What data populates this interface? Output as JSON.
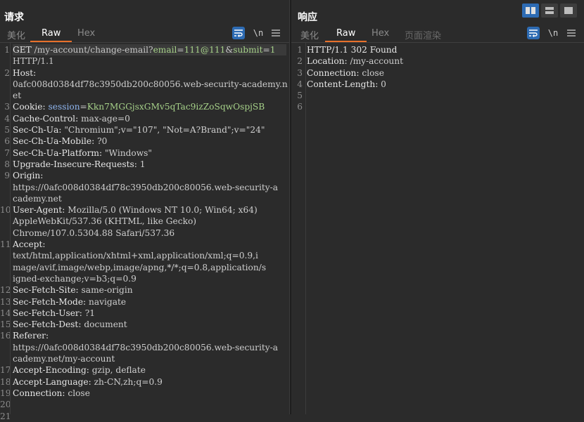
{
  "request": {
    "title": "请求",
    "tabs": [
      {
        "label": "美化",
        "state": "inactive"
      },
      {
        "label": "Raw",
        "state": "active"
      },
      {
        "label": "Hex",
        "state": "inactive"
      }
    ],
    "newline_toggle": "\\n",
    "menu_icon": "hamburger-menu-icon",
    "gutter": [
      "1",
      "",
      "2",
      "",
      "",
      "3",
      "4",
      "5",
      "6",
      "7",
      "8",
      "9",
      "",
      "",
      "10",
      "",
      "",
      "11",
      "",
      "",
      "",
      "12",
      "13",
      "14",
      "15",
      "16",
      "",
      "",
      "17",
      "18",
      "19",
      "20",
      "21"
    ],
    "lines": [
      {
        "seg": [
          [
            "m",
            "GET "
          ],
          [
            "u",
            "/my-account/change-email?"
          ],
          [
            "pn",
            "email"
          ],
          [
            "u",
            "="
          ],
          [
            "pv",
            "111@111"
          ],
          [
            "u",
            "&"
          ],
          [
            "pn",
            "submit"
          ],
          [
            "u",
            "="
          ],
          [
            "pv",
            "1"
          ]
        ]
      },
      {
        "seg": [
          [
            "u",
            "HTTP/1.1"
          ]
        ]
      },
      {
        "seg": [
          [
            "hk",
            "Host:"
          ]
        ]
      },
      {
        "seg": [
          [
            "hv",
            "0afc008d0384df78c3950db200c80056.web-security-academy.n"
          ]
        ]
      },
      {
        "seg": [
          [
            "hv",
            "et"
          ]
        ]
      },
      {
        "seg": [
          [
            "hk",
            "Cookie: "
          ],
          [
            "ck",
            "session"
          ],
          [
            "u",
            "="
          ],
          [
            "cv",
            "Kkn7MGGjsxGMv5qTac9izZoSqwOspjSB"
          ]
        ]
      },
      {
        "seg": [
          [
            "hk",
            "Cache-Control: "
          ],
          [
            "hv",
            "max-age=0"
          ]
        ]
      },
      {
        "seg": [
          [
            "hk",
            "Sec-Ch-Ua: "
          ],
          [
            "hv",
            "\"Chromium\";v=\"107\", \"Not=A?Brand\";v=\"24\""
          ]
        ]
      },
      {
        "seg": [
          [
            "hk",
            "Sec-Ch-Ua-Mobile: "
          ],
          [
            "hv",
            "?0"
          ]
        ]
      },
      {
        "seg": [
          [
            "hk",
            "Sec-Ch-Ua-Platform: "
          ],
          [
            "hv",
            "\"Windows\""
          ]
        ]
      },
      {
        "seg": [
          [
            "hk",
            "Upgrade-Insecure-Requests: "
          ],
          [
            "hv",
            "1"
          ]
        ]
      },
      {
        "seg": [
          [
            "hk",
            "Origin:"
          ]
        ]
      },
      {
        "seg": [
          [
            "hv",
            "https://0afc008d0384df78c3950db200c80056.web-security-a"
          ]
        ]
      },
      {
        "seg": [
          [
            "hv",
            "cademy.net"
          ]
        ]
      },
      {
        "seg": [
          [
            "hk",
            "User-Agent: "
          ],
          [
            "hv",
            "Mozilla/5.0 (Windows NT 10.0; Win64; x64)"
          ]
        ]
      },
      {
        "seg": [
          [
            "hv",
            "AppleWebKit/537.36 (KHTML, like Gecko)"
          ]
        ]
      },
      {
        "seg": [
          [
            "hv",
            "Chrome/107.0.5304.88 Safari/537.36"
          ]
        ]
      },
      {
        "seg": [
          [
            "hk",
            "Accept:"
          ]
        ]
      },
      {
        "seg": [
          [
            "hv",
            "text/html,application/xhtml+xml,application/xml;q=0.9,i"
          ]
        ]
      },
      {
        "seg": [
          [
            "hv",
            "mage/avif,image/webp,image/apng,*/*;q=0.8,application/s"
          ]
        ]
      },
      {
        "seg": [
          [
            "hv",
            "igned-exchange;v=b3;q=0.9"
          ]
        ]
      },
      {
        "seg": [
          [
            "hk",
            "Sec-Fetch-Site: "
          ],
          [
            "hv",
            "same-origin"
          ]
        ]
      },
      {
        "seg": [
          [
            "hk",
            "Sec-Fetch-Mode: "
          ],
          [
            "hv",
            "navigate"
          ]
        ]
      },
      {
        "seg": [
          [
            "hk",
            "Sec-Fetch-User: "
          ],
          [
            "hv",
            "?1"
          ]
        ]
      },
      {
        "seg": [
          [
            "hk",
            "Sec-Fetch-Dest: "
          ],
          [
            "hv",
            "document"
          ]
        ]
      },
      {
        "seg": [
          [
            "hk",
            "Referer:"
          ]
        ]
      },
      {
        "seg": [
          [
            "hv",
            "https://0afc008d0384df78c3950db200c80056.web-security-a"
          ]
        ]
      },
      {
        "seg": [
          [
            "hv",
            "cademy.net/my-account"
          ]
        ]
      },
      {
        "seg": [
          [
            "hk",
            "Accept-Encoding: "
          ],
          [
            "hv",
            "gzip, deflate"
          ]
        ]
      },
      {
        "seg": [
          [
            "hk",
            "Accept-Language: "
          ],
          [
            "hv",
            "zh-CN,zh;q=0.9"
          ]
        ]
      },
      {
        "seg": [
          [
            "hk",
            "Connection: "
          ],
          [
            "hv",
            "close"
          ]
        ]
      },
      {
        "seg": [
          [
            "hv",
            ""
          ]
        ]
      },
      {
        "seg": [
          [
            "hv",
            ""
          ]
        ]
      }
    ]
  },
  "response": {
    "title": "响应",
    "tabs": [
      {
        "label": "美化",
        "state": "inactive"
      },
      {
        "label": "Raw",
        "state": "active"
      },
      {
        "label": "Hex",
        "state": "inactive"
      },
      {
        "label": "页面渲染",
        "state": "disabled"
      }
    ],
    "newline_toggle": "\\n",
    "menu_icon": "hamburger-menu-icon",
    "gutter": [
      "1",
      "2",
      "3",
      "4",
      "5",
      "6"
    ],
    "lines": [
      {
        "seg": [
          [
            "m",
            "HTTP/1.1 302 Found"
          ]
        ]
      },
      {
        "seg": [
          [
            "hk",
            "Location: "
          ],
          [
            "hv",
            "/my-account"
          ]
        ]
      },
      {
        "seg": [
          [
            "hk",
            "Connection: "
          ],
          [
            "hv",
            "close"
          ]
        ]
      },
      {
        "seg": [
          [
            "hk",
            "Content-Length: "
          ],
          [
            "hv",
            "0"
          ]
        ]
      },
      {
        "seg": [
          [
            "hv",
            ""
          ]
        ]
      },
      {
        "seg": [
          [
            "hv",
            ""
          ]
        ]
      }
    ]
  },
  "layout_switcher": [
    {
      "icon": "split-horizontal-layout-icon",
      "active": true
    },
    {
      "icon": "split-vertical-layout-icon",
      "active": false
    },
    {
      "icon": "tabs-layout-icon",
      "active": false
    }
  ],
  "colors": {
    "accent": "#e8702a",
    "button_blue": "#2d6bb3",
    "background": "#2b2b2b"
  }
}
